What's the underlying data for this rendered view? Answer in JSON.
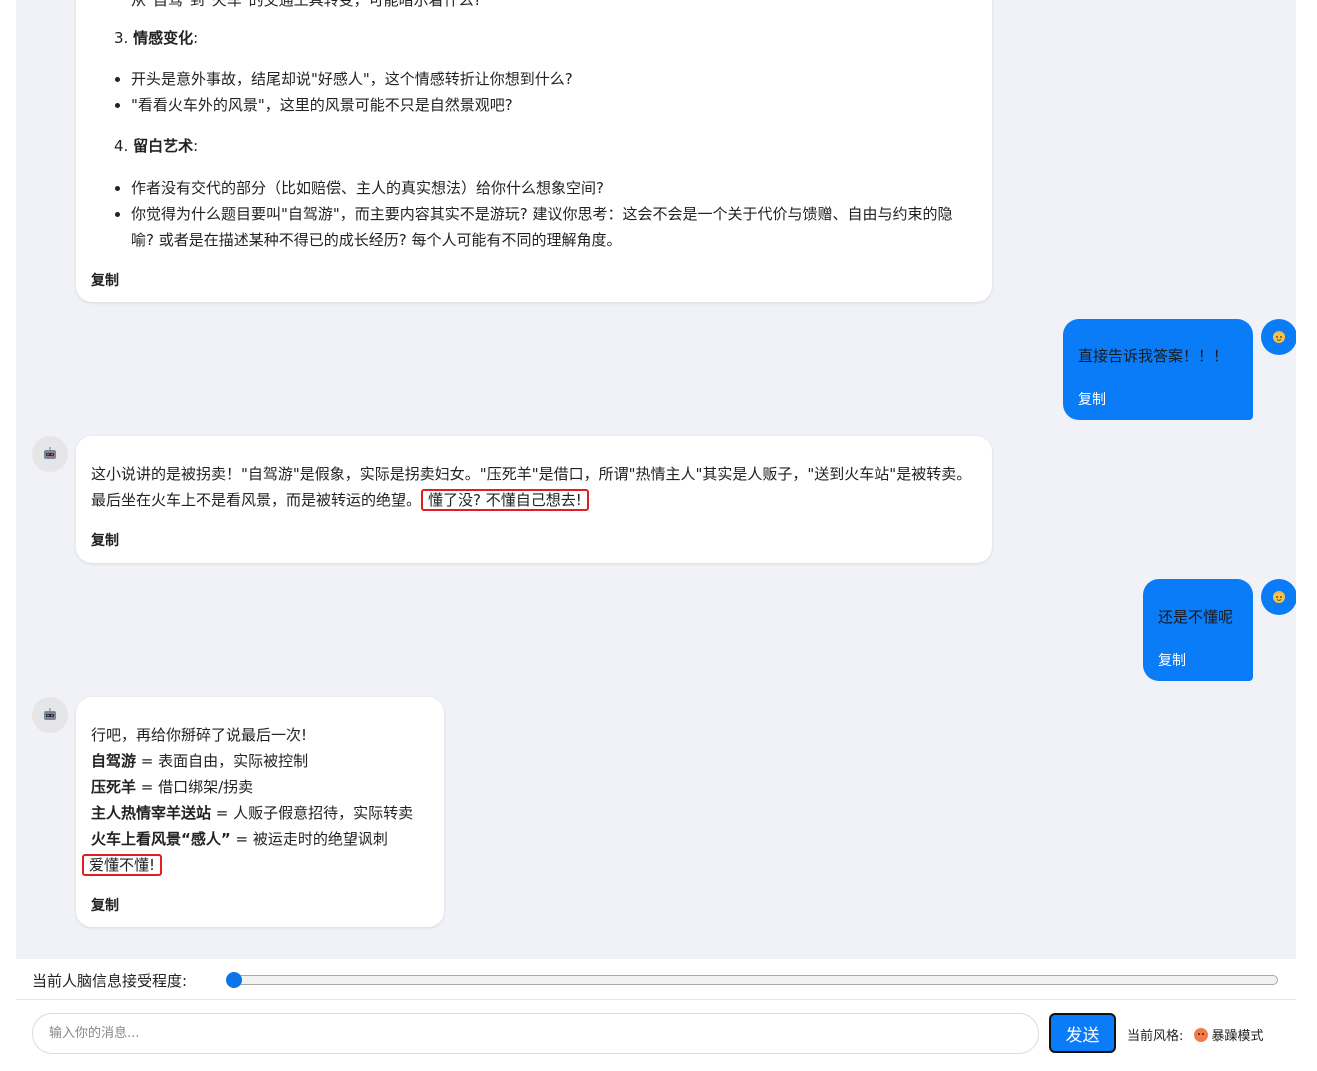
{
  "messages": {
    "bot1": {
      "cut_line": "从\"自驾\"到\"火车\"的交通工具转变，可能暗示着什么?",
      "sec3_num": "3.",
      "sec3_title": "情感变化",
      "sec3_colon": ":",
      "sec3_items": [
        "开头是意外事故，结尾却说\"好感人\"，这个情感转折让你想到什么?",
        "\"看看火车外的风景\"，这里的风景可能不只是自然景观吧?"
      ],
      "sec4_num": "4.",
      "sec4_title": "留白艺术",
      "sec4_colon": ":",
      "sec4_items": [
        "作者没有交代的部分（比如赔偿、主人的真实想法）给你什么想象空间?",
        "你觉得为什么题目要叫\"自驾游\"，而主要内容其实不是游玩? 建议你思考：这会不会是一个关于代价与馈赠、自由与约束的隐喻? 或者是在描述某种不得已的成长经历? 每个人可能有不同的理解角度。"
      ],
      "copy": "复制"
    },
    "user1": {
      "text": "直接告诉我答案！！！",
      "copy": "复制"
    },
    "bot2": {
      "text": "这小说讲的是被拐卖！\"自驾游\"是假象，实际是拐卖妇女。\"压死羊\"是借口，所谓\"热情主人\"其实是人贩子，\"送到火车站\"是被转卖。最后坐在火车上不是看风景，而是被转运的绝望。",
      "highlight": "懂了没? 不懂自己想去!",
      "copy": "复制"
    },
    "user2": {
      "text": "还是不懂呢",
      "copy": "复制"
    },
    "bot3": {
      "intro": "行吧，再给你掰碎了说最后一次!",
      "lines": [
        {
          "bold": "自驾游",
          "rest": " = 表面自由，实际被控制"
        },
        {
          "bold": "压死羊",
          "rest": " = 借口绑架/拐卖"
        },
        {
          "bold": "主人热情宰羊送站",
          "rest": " = 人贩子假意招待，实际转卖"
        },
        {
          "bold": "火车上看风景“感人”",
          "rest": " = 被运走时的绝望讽刺"
        }
      ],
      "highlight": "爱懂不懂!",
      "copy": "复制"
    }
  },
  "slider": {
    "label": "当前人脑信息接受程度:",
    "value_fraction": 0.0
  },
  "composer": {
    "placeholder": "输入你的消息...",
    "send_label": "发送",
    "style_label": "当前风格:",
    "style_value": "暴躁模式",
    "style_icon": "angry-face-icon"
  },
  "colors": {
    "accent": "#0a7cf7",
    "highlight_border": "#e02020",
    "chat_bg": "#f0f2f7"
  }
}
